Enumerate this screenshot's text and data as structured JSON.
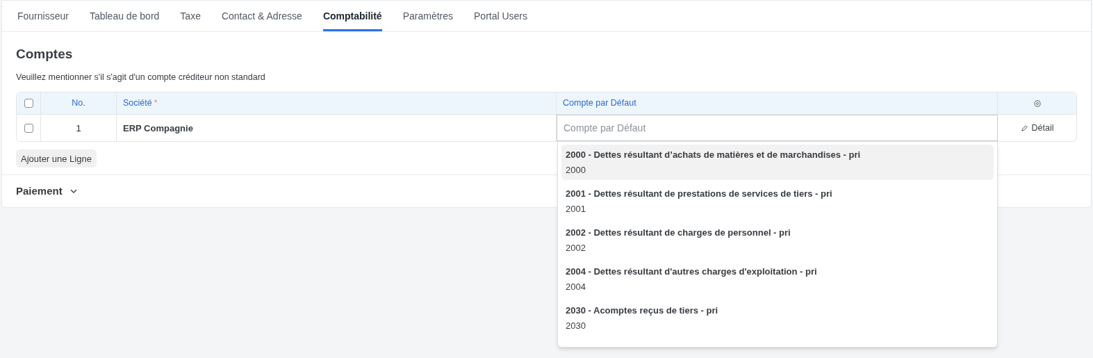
{
  "tabs": [
    {
      "label": "Fournisseur",
      "selected": false
    },
    {
      "label": "Tableau de bord",
      "selected": false
    },
    {
      "label": "Taxe",
      "selected": false
    },
    {
      "label": "Contact & Adresse",
      "selected": false
    },
    {
      "label": "Comptabilité",
      "selected": true
    },
    {
      "label": "Paramètres",
      "selected": false
    },
    {
      "label": "Portal Users",
      "selected": false
    }
  ],
  "section": {
    "title": "Comptes",
    "description": "Veuillez mentionner s'il s'agit d'un compte créditeur non standard"
  },
  "table": {
    "columns": [
      {
        "label": "No."
      },
      {
        "label": "Société",
        "required_mark": "*"
      },
      {
        "label": "Compte par Défaut"
      }
    ],
    "rows": [
      {
        "checked": false,
        "no": "1",
        "company": "ERP Compagnie",
        "account_placeholder": "Compte par Défaut",
        "action": "Détail"
      }
    ],
    "header_checked": false,
    "add_button": "Ajouter une Ligne"
  },
  "dropdown": {
    "items": [
      {
        "title": "2000 - Dettes résultant d’achats de matières et de marchandises - pri",
        "code": "2000",
        "selected": true
      },
      {
        "title": "2001 - Dettes résultant de prestations de services de tiers - pri",
        "code": "2001",
        "selected": false
      },
      {
        "title": "2002 - Dettes résultant de charges de personnel - pri",
        "code": "2002",
        "selected": false
      },
      {
        "title": "2004 - Dettes résultant d'autres charges d'exploitation - pri",
        "code": "2004",
        "selected": false
      },
      {
        "title": "2030 - Acomptes reçus de tiers - pri",
        "code": "2030",
        "selected": false
      }
    ]
  },
  "collapsed_section": {
    "title": "Paiement",
    "expanded": false
  }
}
